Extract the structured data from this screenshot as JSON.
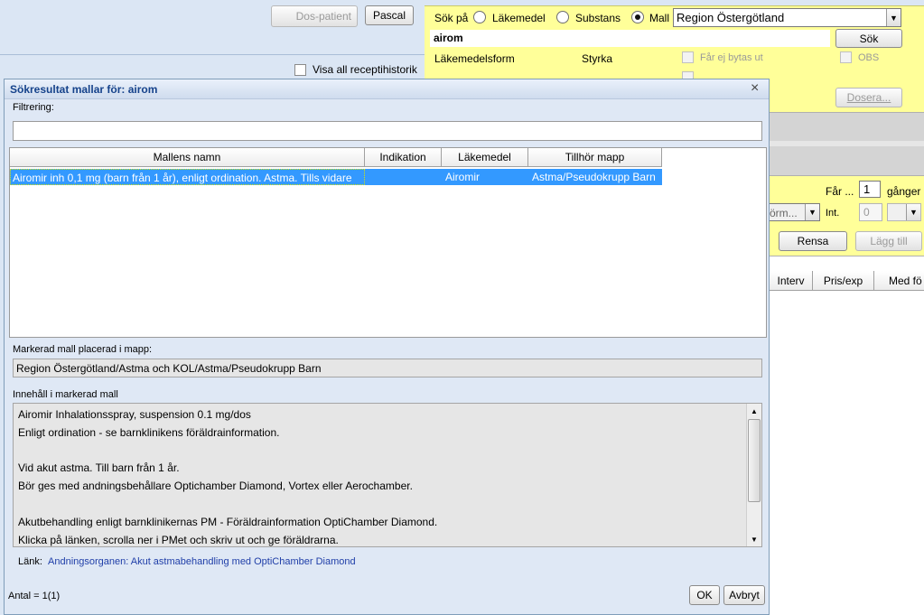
{
  "background": {
    "dos_patient_label": "Dos-patient",
    "pascal_label": "Pascal",
    "visa_all_label": "Visa all receptihistorik"
  },
  "search": {
    "sok_pa_label": "Sök på",
    "radio_lakemedel": "Läkemedel",
    "radio_substans": "Substans",
    "radio_mall": "Mall",
    "template_select": "Region Östergötland",
    "query": "airom",
    "sok_button": "Sök",
    "col_lakemedelsform": "Läkemedelsform",
    "col_styrka": "Styrka",
    "far_ej_bytas_label": "Får ej bytas ut",
    "obs_label": "OBS",
    "dosera_button": "Dosera...",
    "far_label": "Får ...",
    "far_value": "1",
    "ganger_label": "gånger",
    "form_select": "örm...",
    "int_label": "Int.",
    "int_value": "0",
    "rensa_button": "Rensa",
    "lagg_till_button": "Lägg till"
  },
  "right_table": {
    "headers": [
      "Interv",
      "Pris/exp",
      "Med fö"
    ]
  },
  "dialog": {
    "title": "Sökresultat mallar för: airom",
    "filter_label": "Filtrering:",
    "filter_value": "",
    "headers": [
      "Mallens namn",
      "Indikation",
      "Läkemedel",
      "Tillhör mapp"
    ],
    "rows": [
      [
        "Airomir inh 0,1 mg (barn från 1 år), enligt ordination. Astma. Tills vidare",
        "",
        "Airomir",
        "Astma/Pseudokrupp Barn"
      ]
    ],
    "folder_label": "Markerad mall placerad i mapp:",
    "folder_value": "Region Östergötland/Astma och KOL/Astma/Pseudokrupp Barn",
    "content_label": "Innehåll i markerad mall",
    "content_lines": [
      "Airomir Inhalationsspray, suspension 0.1  mg/dos",
      "Enligt ordination - se barnklinikens föräldrainformation.",
      "",
      "Vid akut astma. Till barn från 1 år.",
      "Bör ges med andningsbehållare Optichamber Diamond, Vortex eller Aerochamber.",
      "",
      "Akutbehandling enligt barnklinikernas PM - Föräldrainformation OptiChamber Diamond.",
      "Klicka på länken, scrolla ner i PMet och skriv ut och ge föräldrarna."
    ],
    "link_label": "Länk:",
    "link_text": "Andningsorganen: Akut astmabehandling med OptiChamber Diamond",
    "count": "Antal = 1(1)",
    "ok_button": "OK",
    "cancel_button": "Avbryt"
  },
  "colors": {
    "selection": "#3399ff",
    "yellow_panel": "#ffff99",
    "link": "#1f3ea8"
  }
}
